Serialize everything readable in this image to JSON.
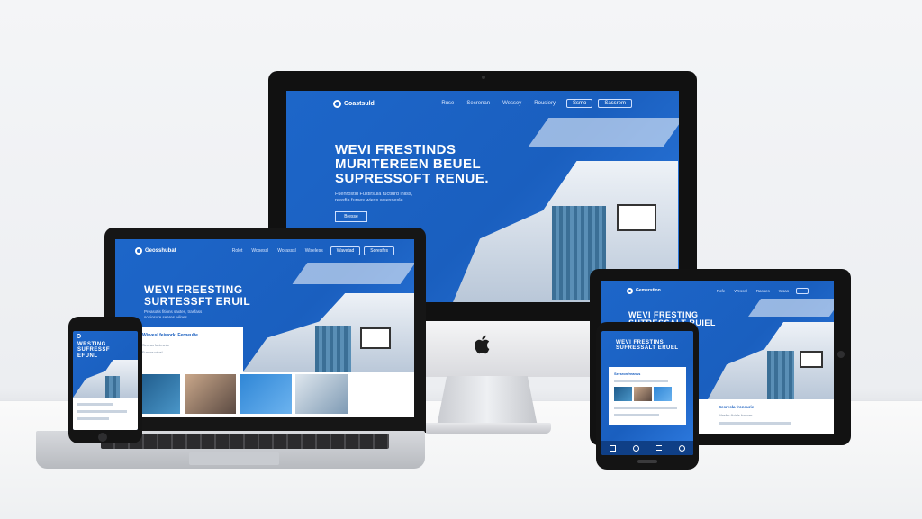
{
  "brand": {
    "name": "Coastsuld"
  },
  "monitor": {
    "nav": [
      "Ruse",
      "Secrenan",
      "Wessey",
      "Rousiery"
    ],
    "buttons": [
      "Ssmo",
      "Sassrem"
    ],
    "hero": [
      "WEVI FRESTINDS",
      "MURITEREEN BEUEL",
      "SUPRESSOFT RENUE."
    ],
    "sub": [
      "Fuenrostid Fustirsuia fuctiurd inllss,",
      "reasfia furses wiess weessesle."
    ],
    "cta": "Bresse"
  },
  "laptop": {
    "brand": "Geosshubat",
    "nav": [
      "Rolet",
      "Wosessl",
      "Worasssl",
      "Wiseless"
    ],
    "buttons": [
      "Wavetad",
      "Soresfes"
    ],
    "hero": [
      "WEVI FREESTING",
      "SURTESSFT ERUIL"
    ],
    "sub": [
      "Preasotis fitions saxtes, trasfass",
      "sosiosure seares wiloes."
    ],
    "panel_title": "Wirvesl feiwork, Ferneulte",
    "panel_lines": [
      "Seresa funiesnis",
      "Furvoe winsl"
    ]
  },
  "tablet": {
    "brand": "Gemerstion",
    "nav": [
      "Rofe",
      "Wesssl",
      "Rasses",
      "Wsas"
    ],
    "hero": [
      "WEVI FRESTING",
      "SUTRESSALT RUIEL"
    ],
    "panel_title": "Sesresla fronsurie",
    "panel_sub": "Wasfer fluinls fusnrer"
  },
  "phone_small": {
    "hero": [
      "WRSTING",
      "SUFRESSF",
      "EFUNL"
    ]
  },
  "phone_large": {
    "hero": [
      "WEVI FRESTINS",
      "SUFRESSALT ERUEL"
    ],
    "card_title": "Sersronfreanss"
  },
  "colors": {
    "primary": "#1a5fbf",
    "accent": "#2e7be0",
    "bg": "#f2f3f5"
  }
}
